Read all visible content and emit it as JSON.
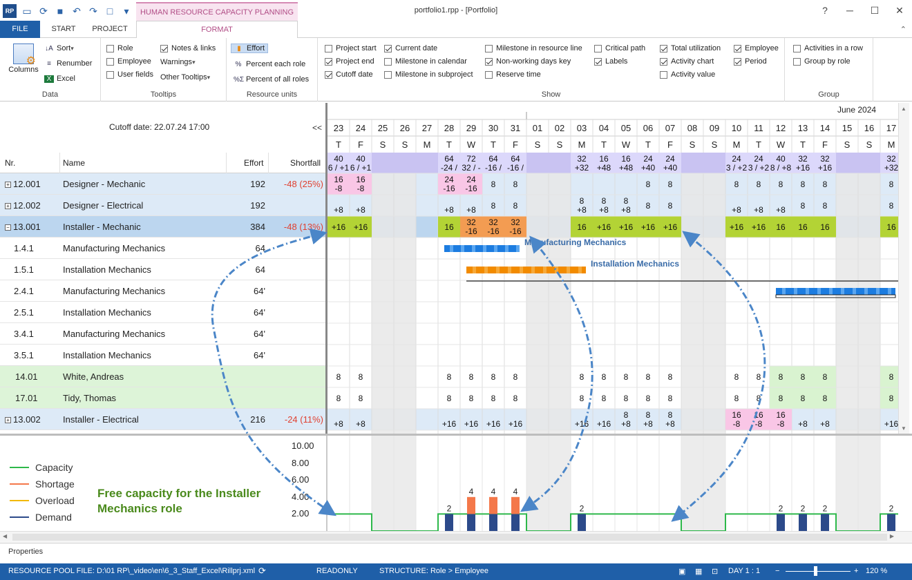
{
  "window": {
    "title": "portfolio1.rpp - [Portfolio]",
    "context_tab": "HUMAN RESOURCE CAPACITY PLANNING"
  },
  "tabs": {
    "file": "FILE",
    "start": "START",
    "project": "PROJECT",
    "format": "FORMAT"
  },
  "ribbon": {
    "data": {
      "label": "Data",
      "columns": "Columns",
      "sort": "Sort",
      "renumber": "Renumber",
      "excel": "Excel"
    },
    "tooltips": {
      "label": "Tooltips",
      "role": "Role",
      "employee": "Employee",
      "user_fields": "User fields",
      "notes_links": "Notes & links",
      "warnings": "Warnings",
      "other_tooltips": "Other Tooltips"
    },
    "units": {
      "label": "Resource units",
      "effort": "Effort",
      "percent_each": "Percent each role",
      "percent_all": "Percent of all roles"
    },
    "show": {
      "label": "Show",
      "project_start": "Project start",
      "project_end": "Project end",
      "cutoff_date": "Cutoff date",
      "current_date": "Current date",
      "milestone_calendar": "Milestone in calendar",
      "milestone_subproject": "Milestone in subproject",
      "milestone_resource": "Milestone in resource line",
      "nonworking_key": "Non-working days key",
      "reserve_time": "Reserve time",
      "critical_path": "Critical path",
      "labels": "Labels",
      "total_util": "Total utilization",
      "activity_chart": "Activity chart",
      "activity_value": "Activity value",
      "employee": "Employee",
      "period": "Period"
    },
    "group": {
      "label": "Group",
      "activities_row": "Activities in a row",
      "group_by_role": "Group by role"
    }
  },
  "cutoff": "Cutoff date: 22.07.24 17:00",
  "collapse": "<<",
  "month_label": "June 2024",
  "columns": {
    "nr": "Nr.",
    "name": "Name",
    "effort": "Effort",
    "shortfall": "Shortfall"
  },
  "rows": [
    {
      "nr": "12.001",
      "name": "Designer - Mechanic",
      "effort": "192",
      "shortfall": "-48 (25%)"
    },
    {
      "nr": "12.002",
      "name": "Designer - Electrical",
      "effort": "192",
      "shortfall": ""
    },
    {
      "nr": "13.001",
      "name": "Installer - Mechanic",
      "effort": "384",
      "shortfall": "-48 (13%)"
    },
    {
      "nr": "1.4.1",
      "name": "Manufacturing Mechanics",
      "effort": "64",
      "shortfall": ""
    },
    {
      "nr": "1.5.1",
      "name": "Installation Mechanics",
      "effort": "64",
      "shortfall": ""
    },
    {
      "nr": "2.4.1",
      "name": "Manufacturing Mechanics",
      "effort": "64'",
      "shortfall": ""
    },
    {
      "nr": "2.5.1",
      "name": "Installation Mechanics",
      "effort": "64'",
      "shortfall": ""
    },
    {
      "nr": "3.4.1",
      "name": "Manufacturing Mechanics",
      "effort": "64'",
      "shortfall": ""
    },
    {
      "nr": "3.5.1",
      "name": "Installation Mechanics",
      "effort": "64'",
      "shortfall": ""
    },
    {
      "nr": "14.01",
      "name": "White, Andreas",
      "effort": "",
      "shortfall": ""
    },
    {
      "nr": "17.01",
      "name": "Tidy, Thomas",
      "effort": "",
      "shortfall": ""
    },
    {
      "nr": "13.002",
      "name": "Installer - Electrical",
      "effort": "216",
      "shortfall": "-24 (11%)"
    }
  ],
  "days": [
    "23",
    "24",
    "25",
    "26",
    "27",
    "28",
    "29",
    "30",
    "31",
    "01",
    "02",
    "03",
    "04",
    "05",
    "06",
    "07",
    "08",
    "09",
    "10",
    "11",
    "12",
    "13",
    "14",
    "15",
    "16",
    "17"
  ],
  "weekdays": [
    "T",
    "F",
    "S",
    "S",
    "M",
    "T",
    "W",
    "T",
    "F",
    "S",
    "S",
    "M",
    "T",
    "W",
    "T",
    "F",
    "S",
    "S",
    "M",
    "T",
    "W",
    "T",
    "F",
    "S",
    "S",
    "M"
  ],
  "total_line": [
    [
      "40",
      "6 / +1"
    ],
    [
      "40",
      "6 / +1"
    ],
    [
      "",
      ""
    ],
    [
      "",
      ""
    ],
    [
      "",
      ""
    ],
    [
      "64",
      "-24 /"
    ],
    [
      "72",
      "32 / -"
    ],
    [
      "64",
      "-16 /"
    ],
    [
      "64",
      "-16 /"
    ],
    [
      "",
      ""
    ],
    [
      "",
      ""
    ],
    [
      "32",
      "+32"
    ],
    [
      "16",
      "+48"
    ],
    [
      "16",
      "+48"
    ],
    [
      "24",
      "+40"
    ],
    [
      "24",
      "+40"
    ],
    [
      "",
      ""
    ],
    [
      "",
      ""
    ],
    [
      "24",
      "3 / +2"
    ],
    [
      "24",
      "3 / +2"
    ],
    [
      "40",
      "8 / +8"
    ],
    [
      "32",
      "+16"
    ],
    [
      "32",
      "+16"
    ],
    [
      "",
      ""
    ],
    [
      "",
      ""
    ],
    [
      "32",
      "+32"
    ]
  ],
  "cells": {
    "12.001": [
      [
        "16",
        "-8"
      ],
      [
        "16",
        "-8"
      ],
      [],
      [],
      [],
      [
        "24",
        "-16"
      ],
      [
        "24",
        "-16"
      ],
      [
        "8"
      ],
      [
        "8"
      ],
      [],
      [],
      [],
      [],
      [],
      [
        "8"
      ],
      [
        "8"
      ],
      [],
      [],
      [
        "8"
      ],
      [
        "8"
      ],
      [
        "8"
      ],
      [
        "8"
      ],
      [
        "8"
      ],
      [],
      [],
      [
        "8"
      ]
    ],
    "12.002": [
      [
        "",
        "+8"
      ],
      [
        "",
        "+8"
      ],
      [],
      [],
      [],
      [
        "",
        "+8"
      ],
      [
        "",
        "+8"
      ],
      [
        "8"
      ],
      [
        "8"
      ],
      [],
      [],
      [
        "8",
        "+8"
      ],
      [
        "8",
        "+8"
      ],
      [
        "8",
        "+8"
      ],
      [
        "8"
      ],
      [
        "8"
      ],
      [],
      [],
      [
        "",
        "+8"
      ],
      [
        "",
        "+8"
      ],
      [
        "",
        "+8"
      ],
      [
        "8"
      ],
      [
        "8"
      ],
      [],
      [],
      [
        "8"
      ]
    ],
    "13.001": [
      [
        "+16"
      ],
      [
        "+16"
      ],
      [],
      [],
      [],
      [
        "16"
      ],
      [
        "32",
        "-16"
      ],
      [
        "32",
        "-16"
      ],
      [
        "32",
        "-16"
      ],
      [],
      [],
      [
        "16"
      ],
      [
        "+16"
      ],
      [
        "+16"
      ],
      [
        "+16"
      ],
      [
        "+16"
      ],
      [],
      [],
      [
        "+16"
      ],
      [
        "+16"
      ],
      [
        "16"
      ],
      [
        "16"
      ],
      [
        "16"
      ],
      [],
      [],
      [
        "16"
      ]
    ],
    "14.01": [
      [
        "8"
      ],
      [
        "8"
      ],
      [],
      [],
      [],
      [
        "8"
      ],
      [
        "8"
      ],
      [
        "8"
      ],
      [
        "8"
      ],
      [],
      [],
      [
        "8"
      ],
      [
        "8"
      ],
      [
        "8"
      ],
      [
        "8"
      ],
      [
        "8"
      ],
      [],
      [],
      [
        "8"
      ],
      [
        "8"
      ],
      [
        "8"
      ],
      [
        "8"
      ],
      [
        "8"
      ],
      [],
      [],
      [
        "8"
      ]
    ],
    "17.01": [
      [
        "8"
      ],
      [
        "8"
      ],
      [],
      [],
      [],
      [
        "8"
      ],
      [
        "8"
      ],
      [
        "8"
      ],
      [
        "8"
      ],
      [],
      [],
      [
        "8"
      ],
      [
        "8"
      ],
      [
        "8"
      ],
      [
        "8"
      ],
      [
        "8"
      ],
      [],
      [],
      [
        "8"
      ],
      [
        "8"
      ],
      [
        "8"
      ],
      [
        "8"
      ],
      [
        "8"
      ],
      [],
      [],
      [
        "8"
      ]
    ],
    "13.002": [
      [
        "",
        "+8"
      ],
      [
        "",
        "+8"
      ],
      [],
      [],
      [],
      [
        "",
        "+16"
      ],
      [
        "",
        "+16"
      ],
      [
        "",
        "+16"
      ],
      [
        "",
        "+16"
      ],
      [],
      [],
      [
        "",
        "+16"
      ],
      [
        "",
        "+16"
      ],
      [
        "8",
        "+8"
      ],
      [
        "8",
        "+8"
      ],
      [
        "8",
        "+8"
      ],
      [],
      [],
      [
        "16",
        "-8"
      ],
      [
        "16",
        "-8"
      ],
      [
        "16",
        "-8"
      ],
      [
        "",
        "+8"
      ],
      [
        "",
        "+8"
      ],
      [],
      [],
      [
        "",
        "+16"
      ]
    ]
  },
  "bar_labels": {
    "mfg": "Manufacturing Mechanics",
    "inst": "Installation Mechanics"
  },
  "legend": {
    "capacity": "Capacity",
    "shortage": "Shortage",
    "overload": "Overload",
    "demand": "Demand"
  },
  "histogram_note": "Free capacity for the Installer Mechanics role",
  "chart_data": {
    "type": "bar",
    "title": "",
    "xlabel": "",
    "ylabel": "",
    "ylim": [
      0,
      10
    ],
    "yticks": [
      "10.00",
      "8.00",
      "6.00",
      "4.00",
      "2.00"
    ],
    "categories": [
      "23",
      "24",
      "25",
      "26",
      "27",
      "28",
      "29",
      "30",
      "31",
      "01",
      "02",
      "03",
      "04",
      "05",
      "06",
      "07",
      "08",
      "09",
      "10",
      "11",
      "12",
      "13",
      "14",
      "15",
      "16",
      "17"
    ],
    "series": [
      {
        "name": "Capacity",
        "values": [
          2,
          2,
          0,
          0,
          0,
          2,
          2,
          2,
          2,
          0,
          0,
          2,
          2,
          2,
          2,
          2,
          0,
          0,
          2,
          2,
          2,
          2,
          2,
          0,
          0,
          2
        ]
      },
      {
        "name": "Demand",
        "values": [
          0,
          0,
          0,
          0,
          0,
          2,
          2,
          2,
          2,
          0,
          0,
          2,
          0,
          0,
          0,
          0,
          0,
          0,
          0,
          0,
          2,
          2,
          2,
          0,
          0,
          2
        ]
      },
      {
        "name": "Shortage",
        "values": [
          0,
          0,
          0,
          0,
          0,
          0,
          2,
          2,
          2,
          0,
          0,
          0,
          0,
          0,
          0,
          0,
          0,
          0,
          0,
          0,
          0,
          0,
          0,
          0,
          0,
          0
        ]
      },
      {
        "name": "Overload",
        "values": [
          0,
          0,
          0,
          0,
          0,
          0,
          0,
          0,
          0,
          0,
          0,
          0,
          0,
          0,
          0,
          0,
          0,
          0,
          0,
          0,
          0,
          0,
          0,
          0,
          0,
          0
        ]
      }
    ],
    "data_labels": [
      "",
      "",
      "",
      "",
      "",
      "2",
      "4",
      "4",
      "4",
      "",
      "",
      "2",
      "",
      "",
      "",
      "",
      "",
      "",
      "",
      "",
      "2",
      "2",
      "2",
      "",
      "",
      "2"
    ],
    "legend": "left"
  },
  "colors": {
    "capacity": "#2db84a",
    "shortage": "#f4784a",
    "overload": "#f2b800",
    "demand": "#2c4a8a",
    "accent": "#1f5fa8"
  },
  "properties": "Properties",
  "status": {
    "pool": "RESOURCE POOL FILE: D:\\01 RP\\_video\\en\\6_3_Staff_Excel\\Rillprj.xml",
    "readonly": "READONLY",
    "structure": "STRUCTURE: Role > Employee",
    "day": "DAY 1 : 1",
    "zoom": "120 %"
  }
}
